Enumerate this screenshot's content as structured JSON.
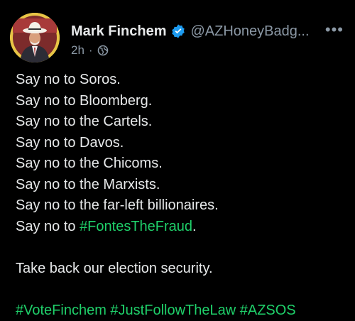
{
  "author": {
    "name": "Mark Finchem",
    "handle": "@AZHoneyBadg...",
    "time": "2h",
    "separator": "·",
    "visibility_icon": "globe-icon",
    "verified_icon": "verified-badge-icon"
  },
  "more_icon": "more-options-icon",
  "post": {
    "lines": [
      "Say no to Soros.",
      "Say no to Bloomberg.",
      "Say no to the Cartels.",
      "Say no to Davos.",
      "Say no to the Chicoms.",
      "Say no to the Marxists.",
      "Say no to the far-left billionaires."
    ],
    "fontes_prefix": "Say no to ",
    "fontes_tag": "#FontesTheFraud",
    "fontes_suffix": ".",
    "closing": "Take back our election security.",
    "hashtags": [
      "#VoteFinchem",
      "#JustFollowTheLaw",
      "#AZSOS"
    ]
  },
  "colors": {
    "background": "#000000",
    "text": "#e7e9ea",
    "muted": "#8b98a5",
    "hashtag": "#1fd06a",
    "verified": "#1d9bf0",
    "avatar_ring": "#e8c546"
  }
}
